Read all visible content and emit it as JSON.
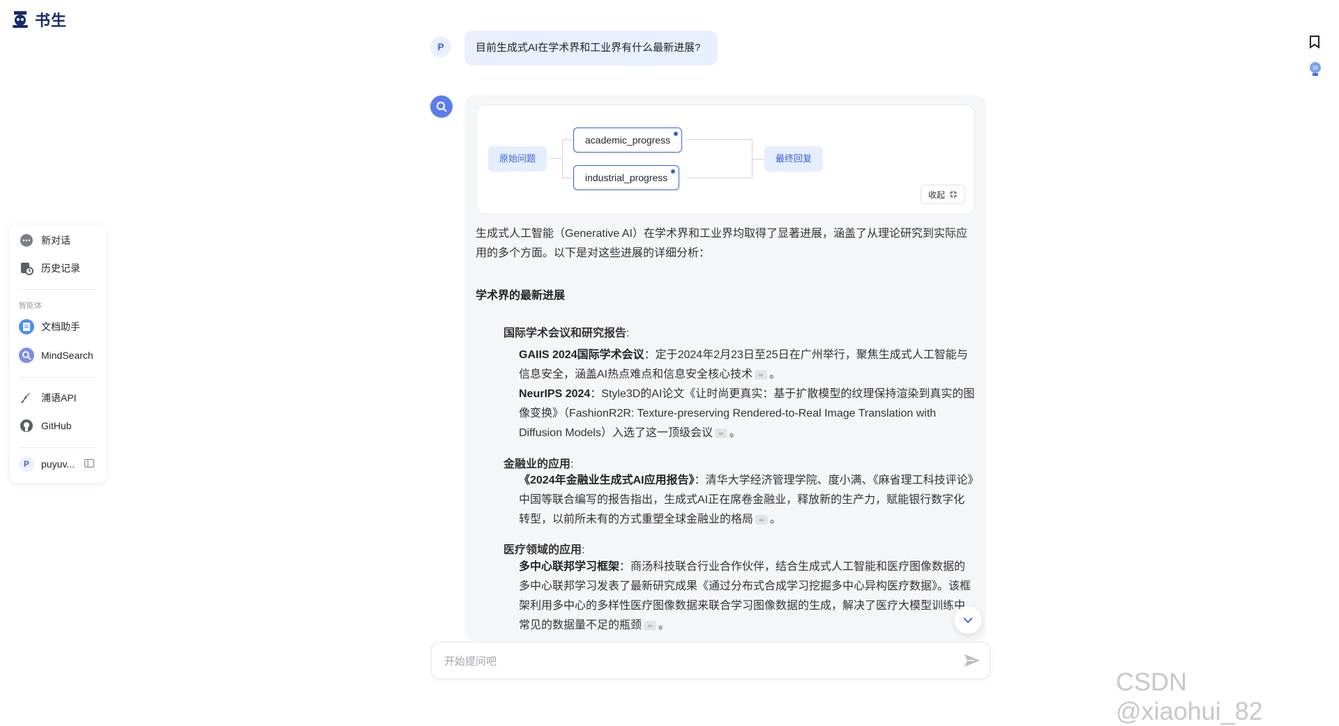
{
  "app": {
    "logo_text": "书生"
  },
  "sidebar": {
    "items": [
      {
        "label": "新对话",
        "icon": "chat-bubble-icon"
      },
      {
        "label": "历史记录",
        "icon": "history-icon"
      }
    ],
    "section_label": "智能体",
    "agents": [
      {
        "label": "文档助手",
        "icon": "document-assistant-icon"
      },
      {
        "label": "MindSearch",
        "icon": "mindsearch-icon"
      }
    ],
    "links": [
      {
        "label": "浦语API",
        "icon": "rocket-icon"
      },
      {
        "label": "GitHub",
        "icon": "github-icon"
      }
    ],
    "user": {
      "initial": "P",
      "name": "puyuv..."
    }
  },
  "conversation": {
    "user_initial": "P",
    "user_message": "目前生成式AI在学术界和工业界有什么最新进展?",
    "graph": {
      "start_node": "原始问题",
      "nodes": [
        "academic_progress",
        "industrial_progress"
      ],
      "end_node": "最终回复",
      "collapse_label": "收起"
    },
    "answer": {
      "intro": "生成式人工智能（Generative AI）在学术界和工业界均取得了显著进展，涵盖了从理论研究到实际应用的多个方面。以下是对这些进展的详细分析：",
      "heading": "学术界的最新进展",
      "sections": [
        {
          "title": "国际学术会议和研究报告",
          "items": [
            {
              "bold": "GAIIS 2024国际学术会议",
              "text": "：定于2024年2月23日至25日在广州举行，聚焦生成式人工智能与信息安全，涵盖AI热点难点和信息安全核心技术",
              "end": "。"
            },
            {
              "bold": "NeurIPS 2024",
              "text": "：Style3D的AI论文《让时尚更真实：基于扩散模型的纹理保持渲染到真实的图像变换》（FashionR2R: Texture-preserving Rendered-to-Real Image Translation with Diffusion Models）入选了这一顶级会议",
              "end": "。"
            }
          ]
        },
        {
          "title": "金融业的应用",
          "items": [
            {
              "bold": "《2024年金融业生成式AI应用报告》",
              "text": "：清华大学经济管理学院、度小满、《麻省理工科技评论》中国等联合编写的报告指出，生成式AI正在席卷金融业，释放新的生产力，赋能银行数字化转型，以前所未有的方式重塑全球金融业的格局",
              "end": "。"
            }
          ]
        },
        {
          "title": "医疗领域的应用",
          "items": [
            {
              "bold": "多中心联邦学习框架",
              "text": "：商汤科技联合行业合作伙伴，结合生成式人工智能和医疗图像数据的多中心联邦学习发表了最新研究成果《通过分布式合成学习挖掘多中心异构医疗数据》。该框架利用多中心的多样性医疗图像数据来联合学习图像数据的生成，解决了医疗大模型训练中常见的数据量不足的瓶颈",
              "end": "。"
            }
          ]
        }
      ]
    }
  },
  "input": {
    "placeholder": "开始提问吧"
  },
  "watermark": "CSDN @xiaohui_82",
  "colors": {
    "accent": "#3561d8",
    "bubble": "#e8f0fe",
    "card": "#f5f6f8"
  }
}
